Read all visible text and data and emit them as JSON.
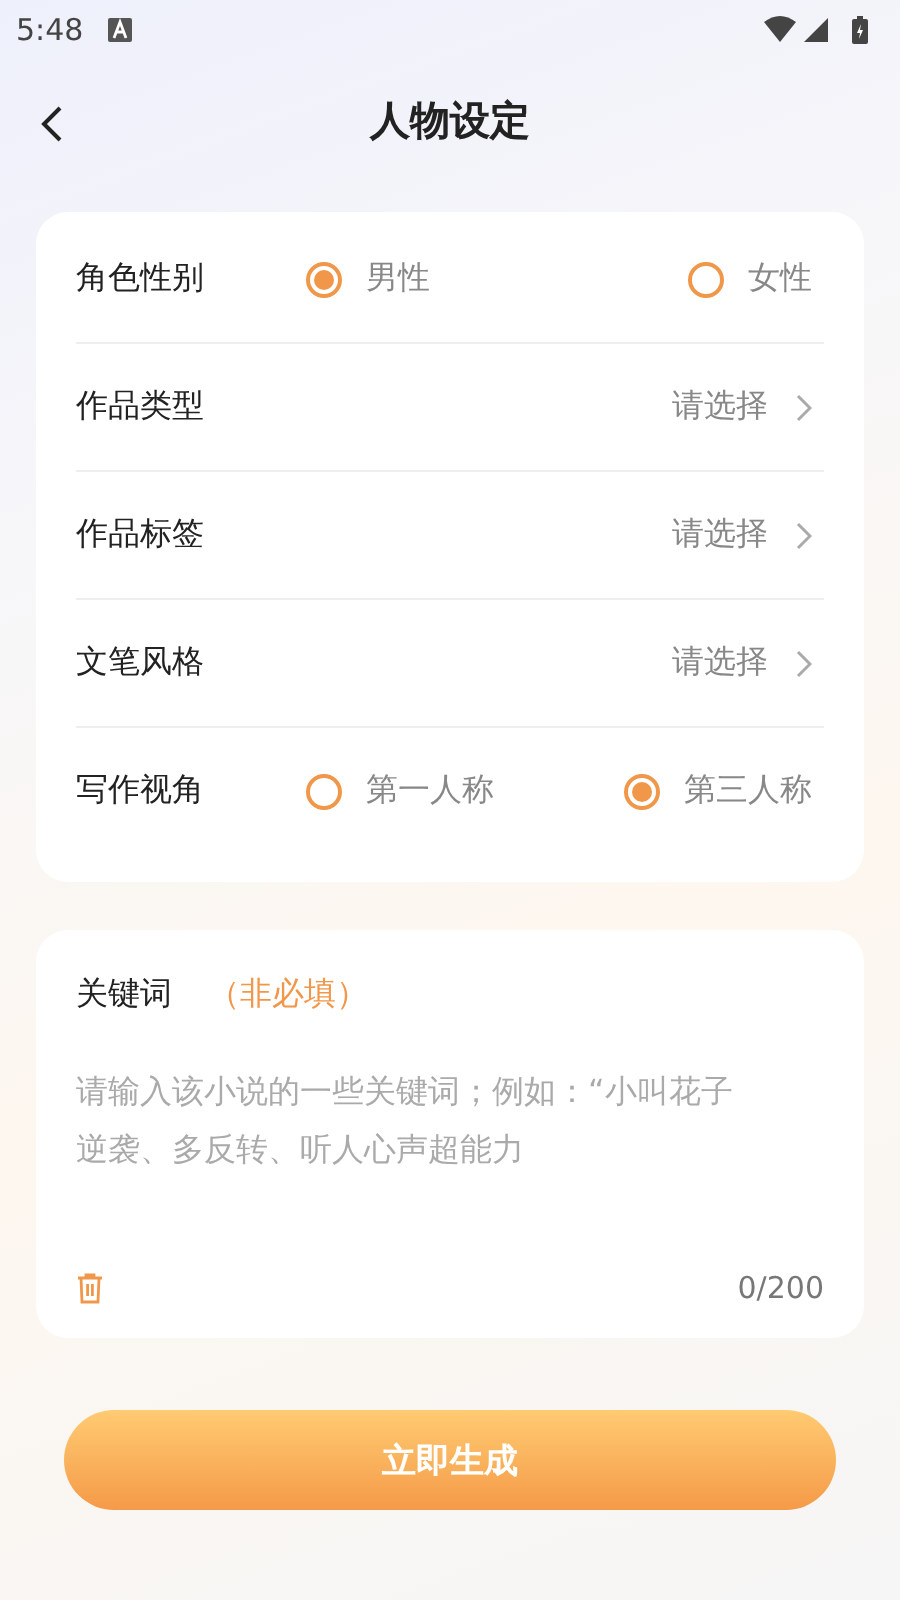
{
  "status_bar": {
    "time": "5:48"
  },
  "header": {
    "title": "人物设定"
  },
  "settings": [
    {
      "kind": "radio",
      "label": "角色性别",
      "options": [
        {
          "label": "男性",
          "selected": true
        },
        {
          "label": "女性",
          "selected": false
        }
      ]
    },
    {
      "kind": "select",
      "label": "作品类型",
      "placeholder": "请选择"
    },
    {
      "kind": "select",
      "label": "作品标签",
      "placeholder": "请选择"
    },
    {
      "kind": "select",
      "label": "文笔风格",
      "placeholder": "请选择"
    },
    {
      "kind": "radio",
      "label": "写作视角",
      "options": [
        {
          "label": "第一人称",
          "selected": false
        },
        {
          "label": "第三人称",
          "selected": true
        }
      ]
    }
  ],
  "keywords": {
    "label": "关键词",
    "note": "（非必填）",
    "placeholder": "请输入该小说的一些关键词；例如：“小叫花子逆袭、多反转、听人心声超能力",
    "counter": "0/200"
  },
  "submit": {
    "label": "立即生成"
  }
}
